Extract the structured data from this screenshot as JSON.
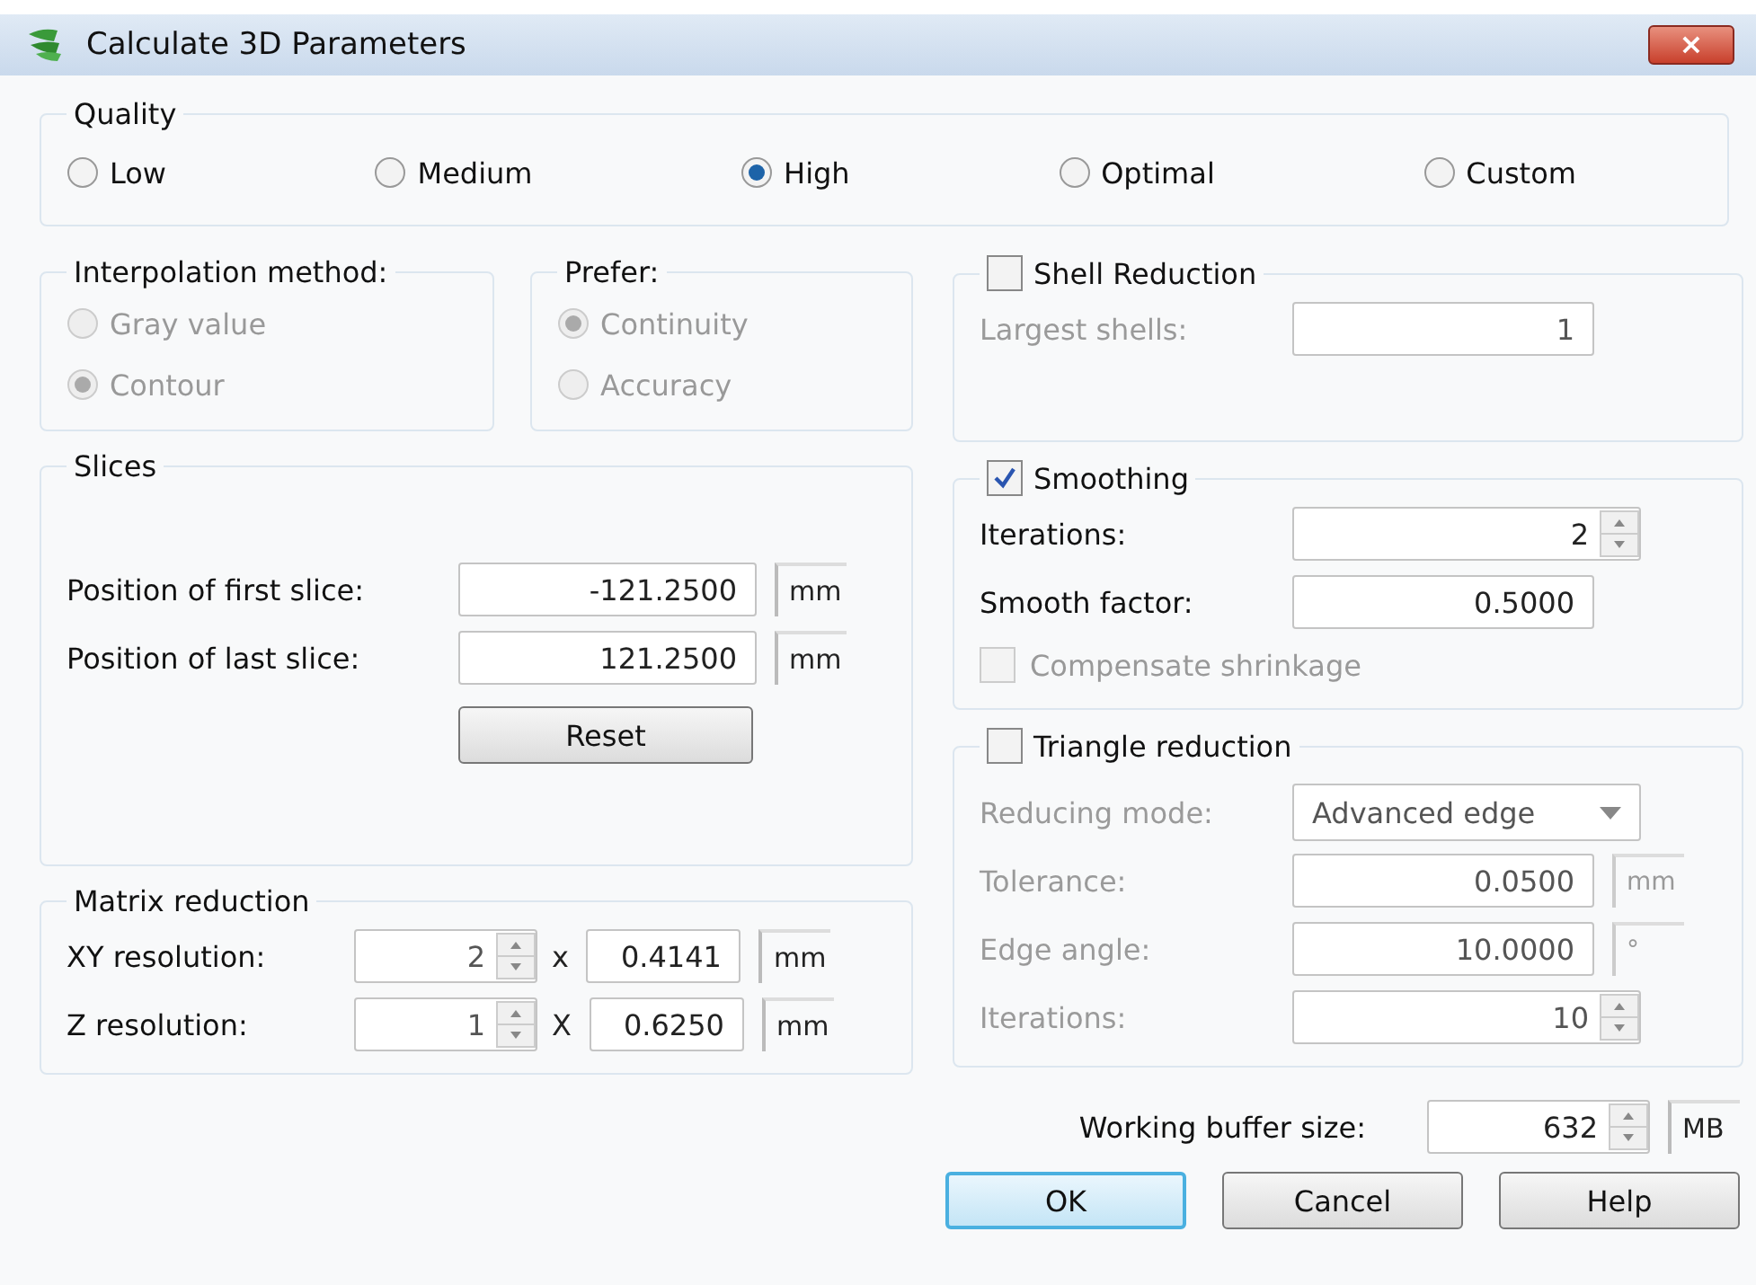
{
  "window": {
    "title": "Calculate 3D Parameters",
    "close": "×"
  },
  "quality": {
    "label": "Quality",
    "options": [
      {
        "label": "Low",
        "selected": false
      },
      {
        "label": "Medium",
        "selected": false
      },
      {
        "label": "High",
        "selected": true
      },
      {
        "label": "Optimal",
        "selected": false
      },
      {
        "label": "Custom",
        "selected": false
      }
    ]
  },
  "interpolation": {
    "label": "Interpolation method:",
    "disabled": true,
    "options": [
      {
        "label": "Gray value",
        "selected": false
      },
      {
        "label": "Contour",
        "selected": true
      }
    ]
  },
  "prefer": {
    "label": "Prefer:",
    "disabled": true,
    "options": [
      {
        "label": "Continuity",
        "selected": true
      },
      {
        "label": "Accuracy",
        "selected": false
      }
    ]
  },
  "slices": {
    "label": "Slices",
    "fields": [
      {
        "label": "Position of first slice:",
        "value": "-121.2500",
        "unit": "mm"
      },
      {
        "label": "Position of last slice:",
        "value": "121.2500",
        "unit": "mm"
      }
    ],
    "reset": "Reset"
  },
  "matrix": {
    "label": "Matrix reduction",
    "rows": [
      {
        "label": "XY resolution:",
        "factor": "2",
        "times": "x",
        "value": "0.4141",
        "unit": "mm"
      },
      {
        "label": "Z resolution:",
        "factor": "1",
        "times": "X",
        "value": "0.6250",
        "unit": "mm"
      }
    ]
  },
  "shell": {
    "label": "Shell Reduction",
    "checked": false,
    "fields": [
      {
        "kind": "text",
        "label": "Largest shells:",
        "value": "1"
      }
    ]
  },
  "smoothing": {
    "label": "Smoothing",
    "checked": true,
    "fields": [
      {
        "kind": "spin",
        "label": "Iterations:",
        "value": "2"
      },
      {
        "kind": "text",
        "label": "Smooth factor:",
        "value": "0.5000"
      }
    ],
    "compensate": {
      "label": "Compensate shrinkage",
      "checked": false
    }
  },
  "triangle": {
    "label": "Triangle reduction",
    "checked": false,
    "fields": [
      {
        "kind": "dropdown",
        "label": "Reducing mode:",
        "value": "Advanced edge"
      },
      {
        "kind": "text",
        "label": "Tolerance:",
        "value": "0.0500",
        "unit": "mm"
      },
      {
        "kind": "text",
        "label": "Edge angle:",
        "value": "10.0000",
        "unit": "°"
      },
      {
        "kind": "spin",
        "label": "Iterations:",
        "value": "10"
      }
    ]
  },
  "buffer": {
    "label": "Working buffer size:",
    "value": "632",
    "unit": "MB"
  },
  "buttons": [
    {
      "label": "OK",
      "default": true
    },
    {
      "label": "Cancel",
      "default": false
    },
    {
      "label": "Help",
      "default": false
    }
  ]
}
